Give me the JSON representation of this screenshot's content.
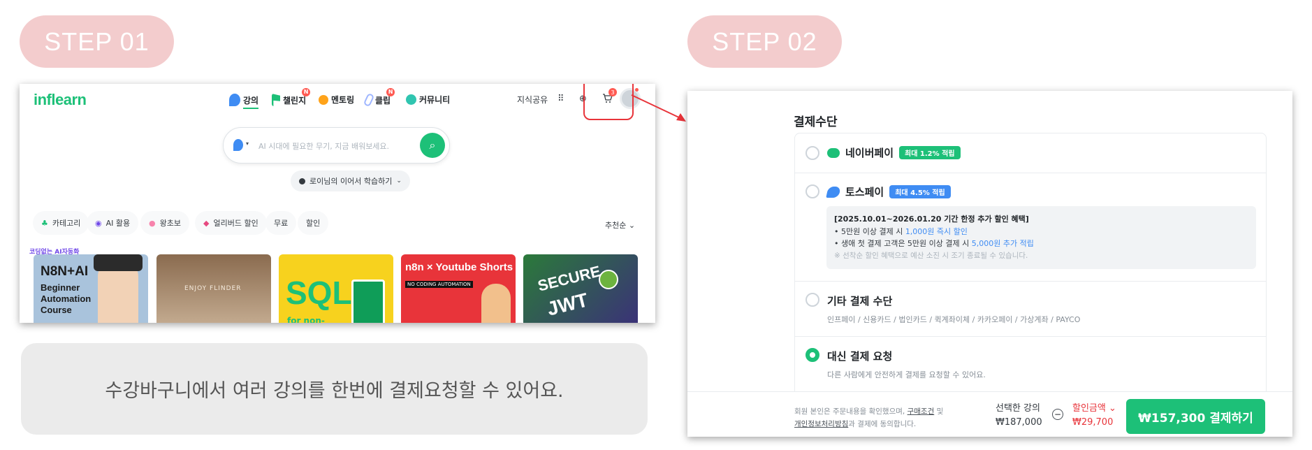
{
  "step1": {
    "label": "STEP 01"
  },
  "step2": {
    "label": "STEP 02"
  },
  "shot1": {
    "logo": "inflearn",
    "nav": [
      {
        "label": "강의",
        "icon": "lecture-icon",
        "color": "#3f8cf3"
      },
      {
        "label": "챌린지",
        "icon": "flag-icon",
        "color": "#1dc078",
        "badge": "N"
      },
      {
        "label": "멘토링",
        "icon": "chat-icon",
        "color": "#ffa31a"
      },
      {
        "label": "클립",
        "icon": "clip-icon",
        "color": "#9fb6ff",
        "badge": "N"
      },
      {
        "label": "커뮤니티",
        "icon": "community-icon",
        "color": "#30c5b0"
      }
    ],
    "knowledge_share": "지식공유",
    "cart_badge": "3",
    "search_placeholder": "AI 시대에 필요한 무기, 지금 배워보세요.",
    "resume_label": "로이님의 이어서 학습하기",
    "chips": [
      {
        "label": "카테고리"
      },
      {
        "label": "AI 활용"
      },
      {
        "label": "왕초보"
      },
      {
        "label": "얼리버드 할인"
      },
      {
        "label": "무료"
      },
      {
        "label": "할인"
      }
    ],
    "sort_label": "추천순",
    "cards": [
      {
        "label": "코딩없는 AI자동화",
        "title": "N8N+AI",
        "sub1": "Beginner",
        "sub2": "Automation",
        "sub3": "Course"
      },
      {
        "label": "",
        "title": "ENJOY FLINDER",
        "sub1": "",
        "sub2": "",
        "sub3": ""
      },
      {
        "label": "",
        "title": "SQL",
        "sub1": "for non-",
        "sub2": "",
        "sub3": ""
      },
      {
        "label": "",
        "title": "n8n × Youtube Shorts",
        "sub1": "NO CODING AUTOMATION",
        "sub2": "",
        "sub3": ""
      },
      {
        "label": "",
        "title": "SECURE",
        "sub1": "JWT",
        "sub2": "",
        "sub3": ""
      }
    ]
  },
  "caption": "수강바구니에서 여러 강의를 한번에 결제요청할 수 있어요.",
  "shot2": {
    "title": "결제수단",
    "options": [
      {
        "label": "네이버페이",
        "tag": "최대 1.2% 적립",
        "tag_color": "#1dc078"
      },
      {
        "label": "토스페이",
        "tag": "최대 4.5% 적립",
        "tag_color": "#3f8cf3"
      },
      {
        "label": "기타 결제 수단",
        "desc": "인프페이 / 신용카드 / 법인카드 / 퀵계좌이체 / 카카오페이 / 가상계좌 / PAYCO"
      },
      {
        "label": "대신 결제 요청",
        "desc": "다른 사람에게 안전하게 결제를 요청할 수 있어요."
      }
    ],
    "benefit": {
      "title": "[2025.10.01~2026.01.20 기간 한정 추가 할인 혜택]",
      "line1_a": "• 5만원 이상 결제 시 ",
      "line1_b": "1,000원 즉시 할인",
      "line2_a": "• 생애 첫 결제 고객은 5만원 이상 결제 시 ",
      "line2_b": "5,000원 추가 적립",
      "note": "※ 선착순 할인 혜택으로 예산 소진 시 조기 종료될 수 있습니다."
    },
    "footer": {
      "agree1_a": "회원 본인은 주문내용을 확인했으며, ",
      "agree1_link": "구매조건",
      "agree1_b": " 및",
      "agree2_link": "개인정보처리방침",
      "agree2_b": "과 결제에 동의합니다.",
      "selected_label": "선택한 강의",
      "selected_price": "₩187,000",
      "discount_label": "할인금액",
      "discount_price": "₩29,700",
      "pay_button": "₩157,300 결제하기"
    }
  },
  "colors": {
    "accent": "#1dc078",
    "highlight": "#e8343a",
    "step_bg": "#f3cccd"
  }
}
